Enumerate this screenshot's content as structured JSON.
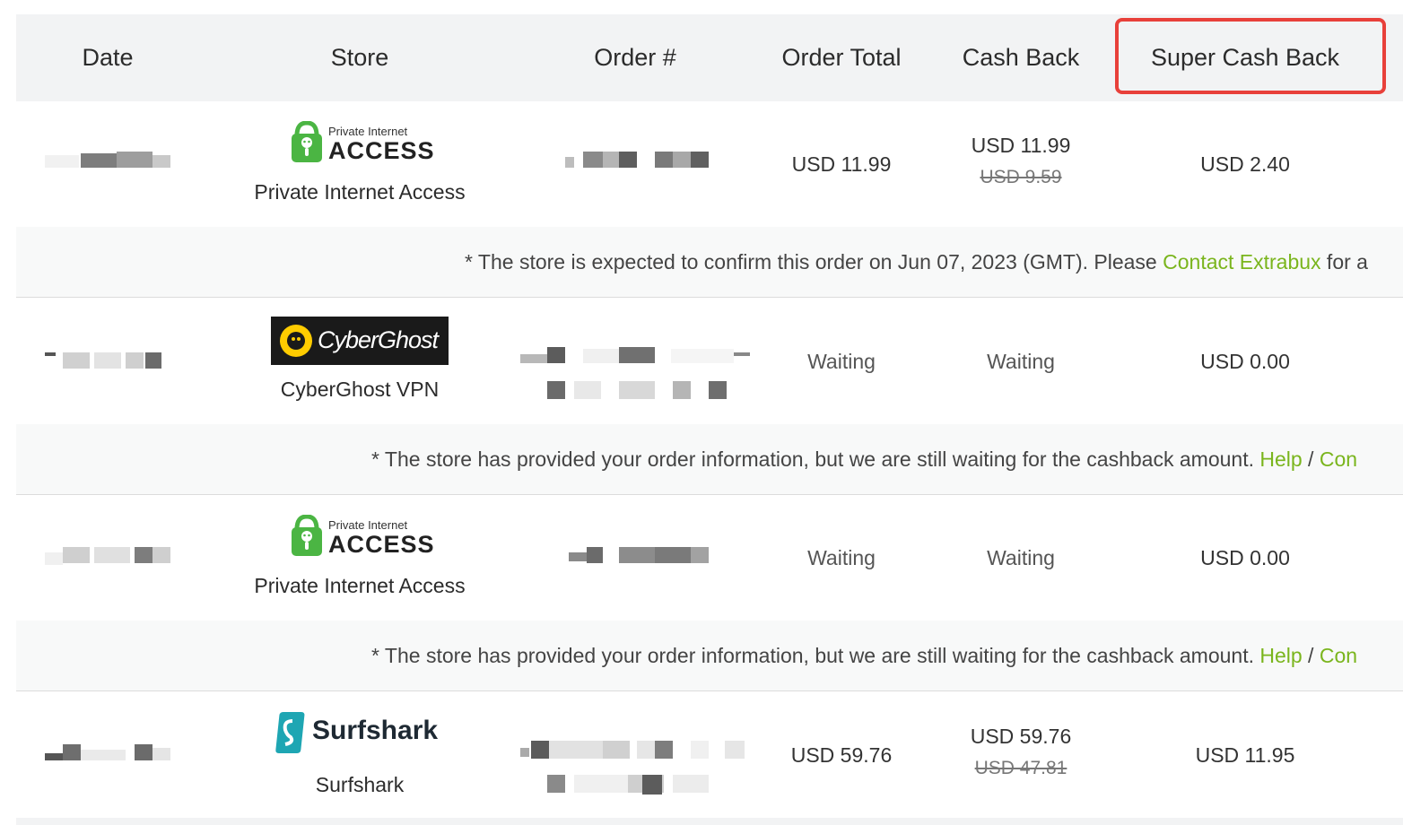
{
  "header": {
    "date": "Date",
    "store": "Store",
    "order": "Order #",
    "order_total": "Order Total",
    "cash_back": "Cash Back",
    "super_cash_back": "Super Cash Back"
  },
  "rows": [
    {
      "store_logo": "private-internet-access-logo",
      "logo_text_small": "Private Internet",
      "logo_text_big": "ACCESS",
      "store_name": "Private Internet Access",
      "order_total": "USD 11.99",
      "cash_back": "USD 11.99",
      "cash_back_old": "USD 9.59",
      "super_cash_back": "USD 2.40"
    },
    {
      "store_logo": "cyberghost-logo",
      "logo_text": "CyberGhost",
      "store_name": "CyberGhost VPN",
      "order_total": "Waiting",
      "cash_back": "Waiting",
      "super_cash_back": "USD 0.00"
    },
    {
      "store_logo": "private-internet-access-logo",
      "logo_text_small": "Private Internet",
      "logo_text_big": "ACCESS",
      "store_name": "Private Internet Access",
      "order_total": "Waiting",
      "cash_back": "Waiting",
      "super_cash_back": "USD 0.00"
    },
    {
      "store_logo": "surfshark-logo",
      "logo_text": "Surfshark",
      "store_name": "Surfshark",
      "order_total": "USD 59.76",
      "cash_back": "USD 59.76",
      "cash_back_old": "USD 47.81",
      "super_cash_back": "USD 11.95"
    }
  ],
  "notes": [
    {
      "text": "* The store is expected to confirm this order on Jun 07, 2023 (GMT). Please ",
      "link1": "Contact Extrabux",
      "sep": " for a",
      "link2": ""
    },
    {
      "text": "* The store has provided your order information, but we are still waiting for the cashback amount. ",
      "link1": "Help",
      "sep": " / ",
      "link2": "Con"
    },
    {
      "text": "* The store has provided your order information, but we are still waiting for the cashback amount. ",
      "link1": "Help",
      "sep": " / ",
      "link2": "Con"
    }
  ],
  "colors": {
    "accent_link": "#7ab51d",
    "highlight_box": "#e8403a",
    "header_bg": "#f2f3f4",
    "pia_green": "#4bb543",
    "cyberghost_bg": "#1a1a1a",
    "cyberghost_yellow": "#ffcc00",
    "surfshark_teal": "#1ea6b3"
  }
}
